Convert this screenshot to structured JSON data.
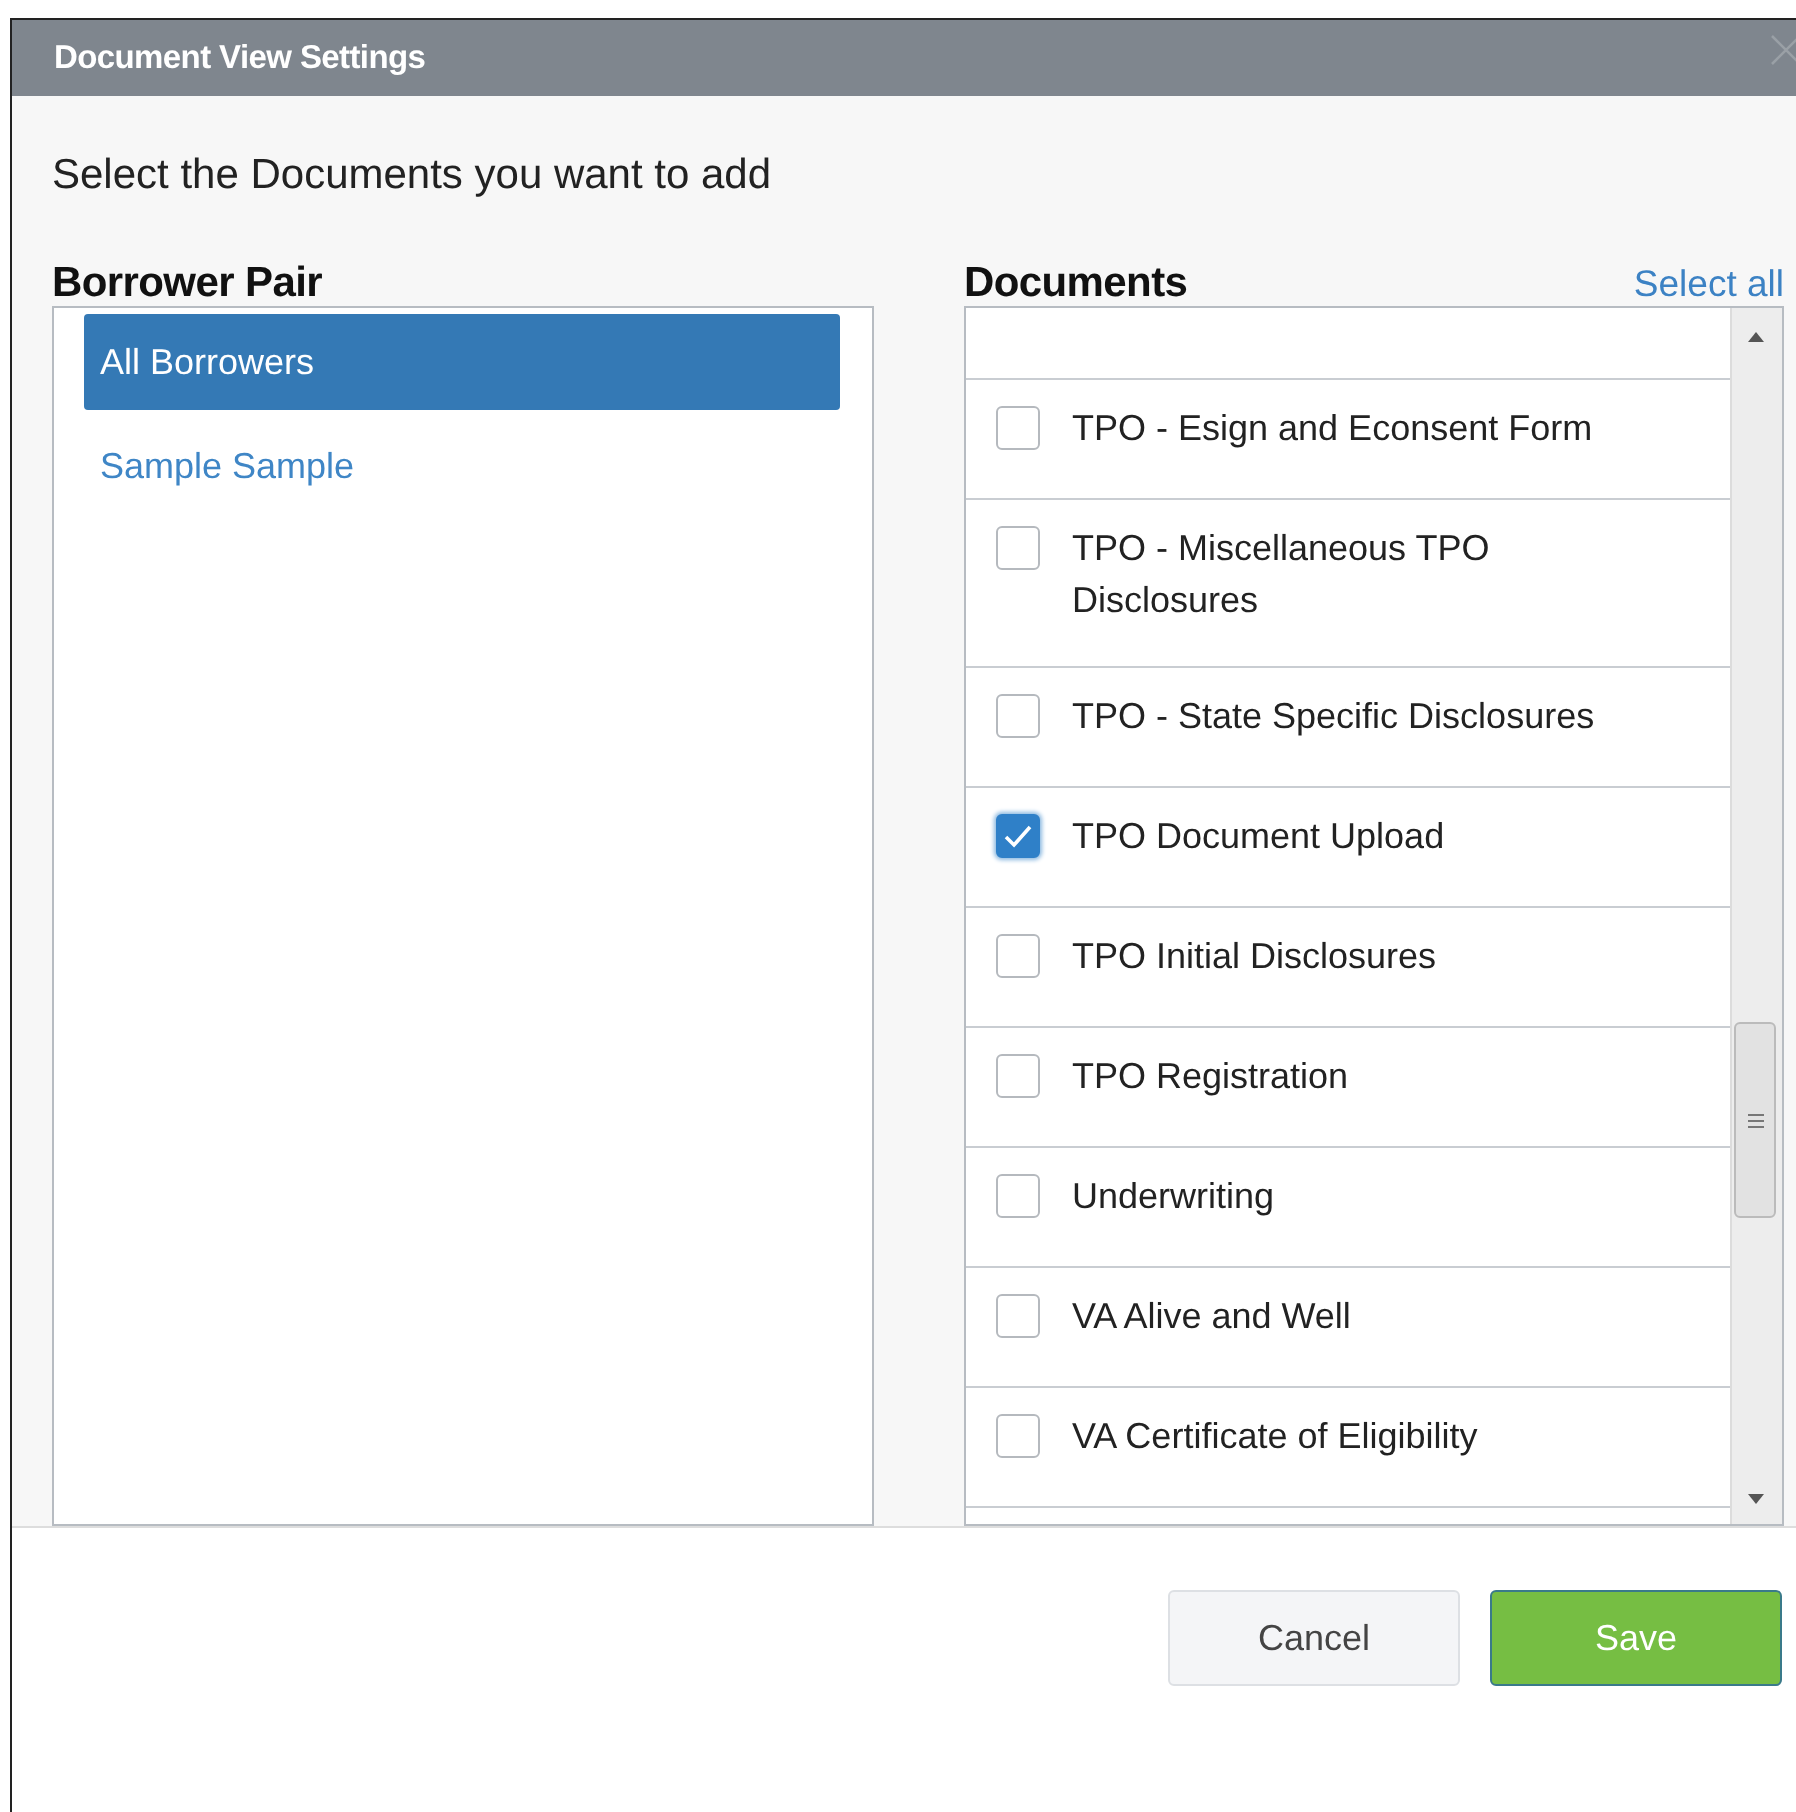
{
  "window": {
    "title": "Document View Settings"
  },
  "instruction": "Select the Documents you want to add",
  "borrower_pair": {
    "heading": "Borrower Pair",
    "items": [
      {
        "label": "All Borrowers",
        "selected": true
      },
      {
        "label": "Sample Sample",
        "selected": false
      }
    ]
  },
  "documents": {
    "heading": "Documents",
    "select_all": "Select all",
    "items": [
      {
        "label": "TPO - Esign and Econsent Form",
        "checked": false
      },
      {
        "label": "TPO - Miscellaneous TPO Disclosures",
        "checked": false
      },
      {
        "label": "TPO - State Specific Disclosures",
        "checked": false
      },
      {
        "label": "TPO Document Upload",
        "checked": true
      },
      {
        "label": "TPO Initial Disclosures",
        "checked": false
      },
      {
        "label": "TPO Registration",
        "checked": false
      },
      {
        "label": "Underwriting",
        "checked": false
      },
      {
        "label": "VA Alive and Well",
        "checked": false
      },
      {
        "label": "VA Certificate of Eligibility",
        "checked": false
      }
    ]
  },
  "buttons": [
    {
      "label": "Cancel",
      "kind": "secondary"
    },
    {
      "label": "Save",
      "kind": "primary"
    }
  ]
}
